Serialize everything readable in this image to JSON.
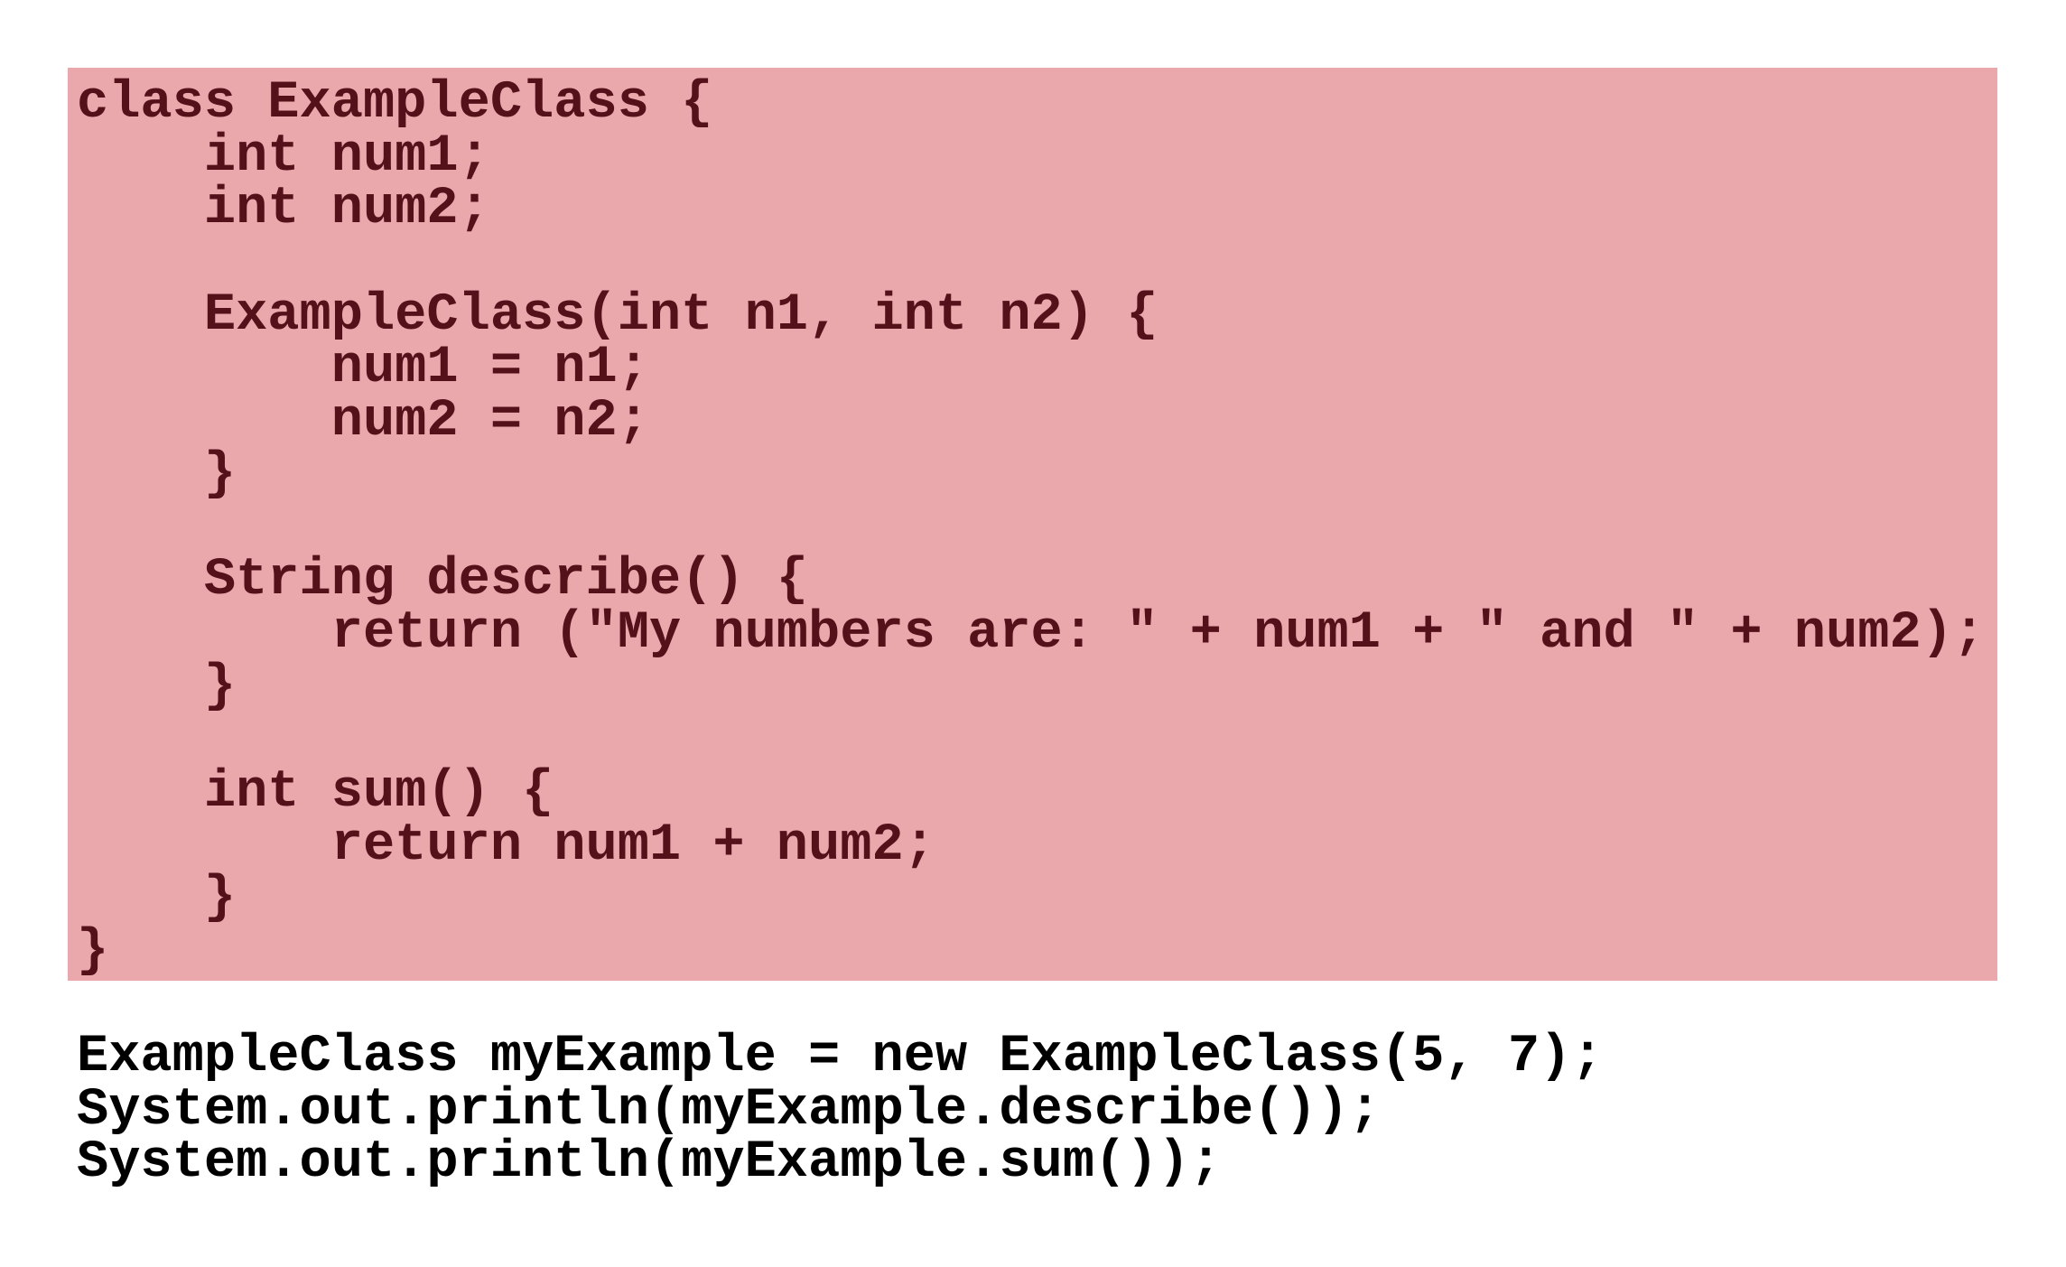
{
  "highlight_color": "#eaa8ad",
  "class_code_color": "#55111a",
  "class_code": [
    "class ExampleClass {",
    "    int num1;",
    "    int num2;",
    "",
    "    ExampleClass(int n1, int n2) {",
    "        num1 = n1;",
    "        num2 = n2;",
    "    }",
    "",
    "    String describe() {",
    "        return (\"My numbers are: \" + num1 + \" and \" + num2);",
    "    }",
    "",
    "    int sum() {",
    "        return num1 + num2;",
    "    }",
    "}"
  ],
  "usage_code": [
    "ExampleClass myExample = new ExampleClass(5, 7);",
    "System.out.println(myExample.describe());",
    "System.out.println(myExample.sum());"
  ]
}
